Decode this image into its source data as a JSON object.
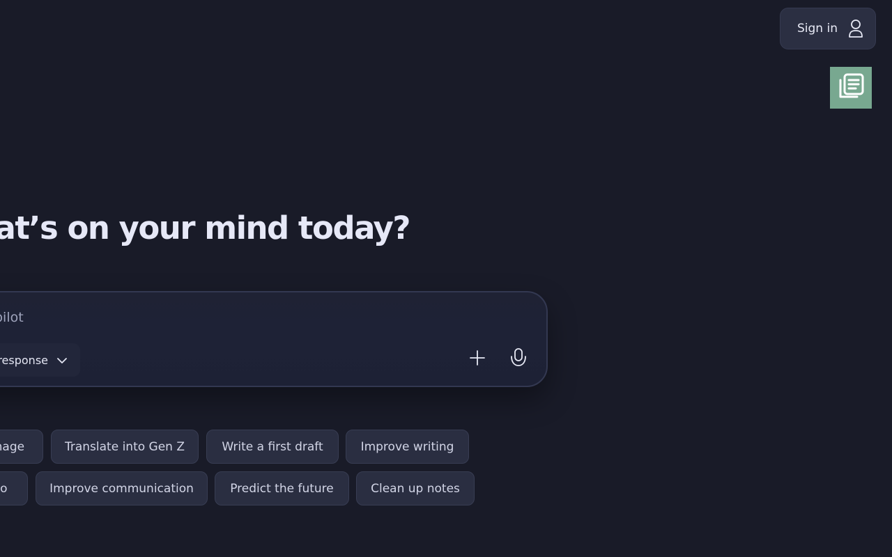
{
  "header": {
    "sign_in_label": "Sign in",
    "user_icon": "user-icon",
    "news_icon": "news-icon",
    "news_tile_color": "#78a890"
  },
  "main": {
    "headline": "what’s on your mind today?"
  },
  "composer": {
    "placeholder": "pilot",
    "mode_label": "response",
    "mode_icon": "chevron-down-icon",
    "add_icon": "plus-icon",
    "mic_icon": "microphone-icon"
  },
  "suggestions": {
    "row1": [
      "mage",
      "Translate into Gen Z",
      "Write a first draft",
      "Improve writing"
    ],
    "row2": [
      "go",
      "Improve communication",
      "Predict the future",
      "Clean up notes"
    ]
  },
  "colors": {
    "background": "#191b28",
    "chip_background": "#2a2e41",
    "text": "#e6e8f5"
  }
}
